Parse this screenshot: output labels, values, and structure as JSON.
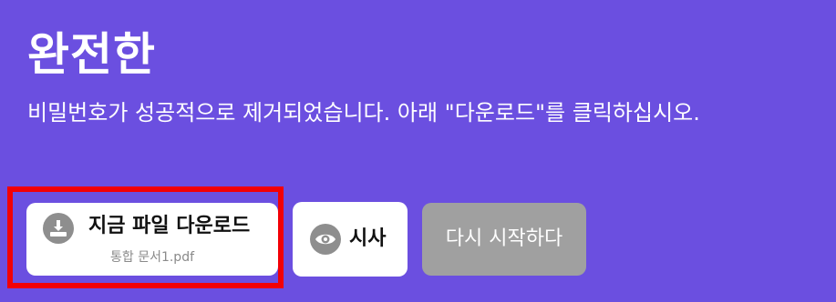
{
  "header": {
    "title": "완전한",
    "subtitle": "비밀번호가 성공적으로 제거되었습니다. 아래 \"다운로드\"를 클릭하십시오."
  },
  "actions": {
    "download": {
      "label": "지금 파일 다운로드",
      "filename": "통합 문서1.pdf",
      "icon": "download-icon"
    },
    "preview": {
      "label": "시사",
      "icon": "eye-icon"
    },
    "restart": {
      "label": "다시 시작하다"
    }
  },
  "colors": {
    "background": "#6b4fe0",
    "highlight_border": "#f20006",
    "button_primary_bg": "#ffffff",
    "button_disabled_bg": "#a0a0a0",
    "icon_circle": "#8e8e8e"
  }
}
